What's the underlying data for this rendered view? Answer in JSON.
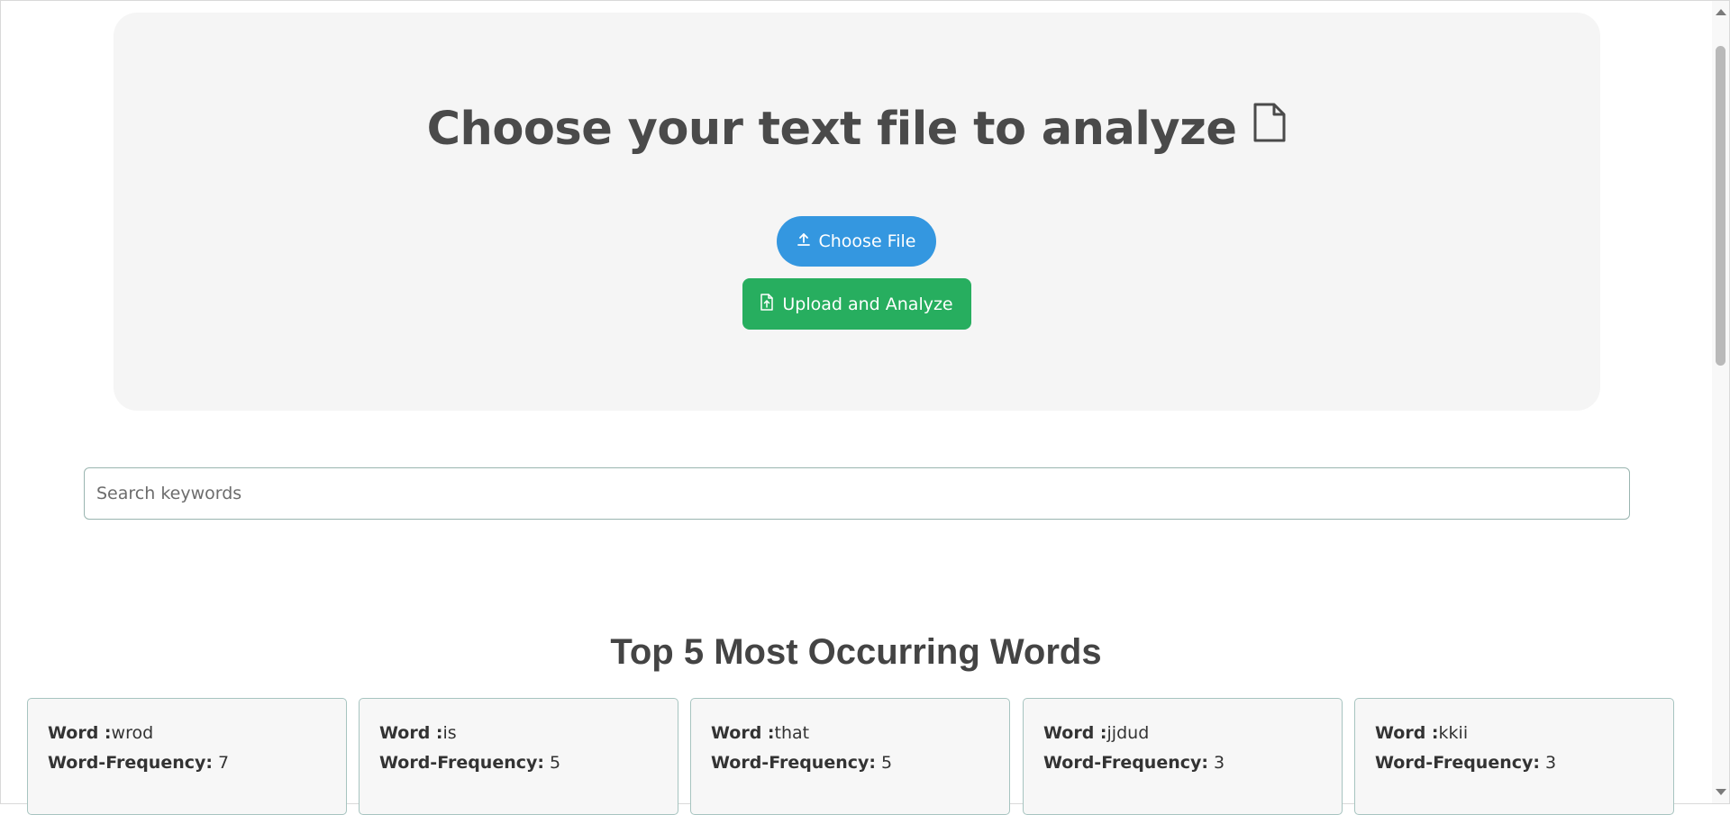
{
  "upload": {
    "title": "Choose your text file to analyze",
    "title_icon": "document-icon",
    "choose_label": "Choose File",
    "choose_icon": "upload-icon",
    "upload_label": "Upload and Analyze",
    "upload_icon": "file-upload-icon"
  },
  "search": {
    "placeholder": "Search keywords",
    "value": ""
  },
  "top_words": {
    "title": "Top 5 Most Occurring Words",
    "word_label": "Word :",
    "freq_label": "Word-Frequency:",
    "items": [
      {
        "word": "wrod",
        "frequency": "7"
      },
      {
        "word": "is",
        "frequency": "5"
      },
      {
        "word": "that",
        "frequency": "5"
      },
      {
        "word": "jjdud",
        "frequency": "3"
      },
      {
        "word": "kkii",
        "frequency": "3"
      }
    ]
  },
  "colors": {
    "choose_button": "#3497e0",
    "upload_button": "#27ae5f",
    "card_background": "#f5f5f5"
  }
}
